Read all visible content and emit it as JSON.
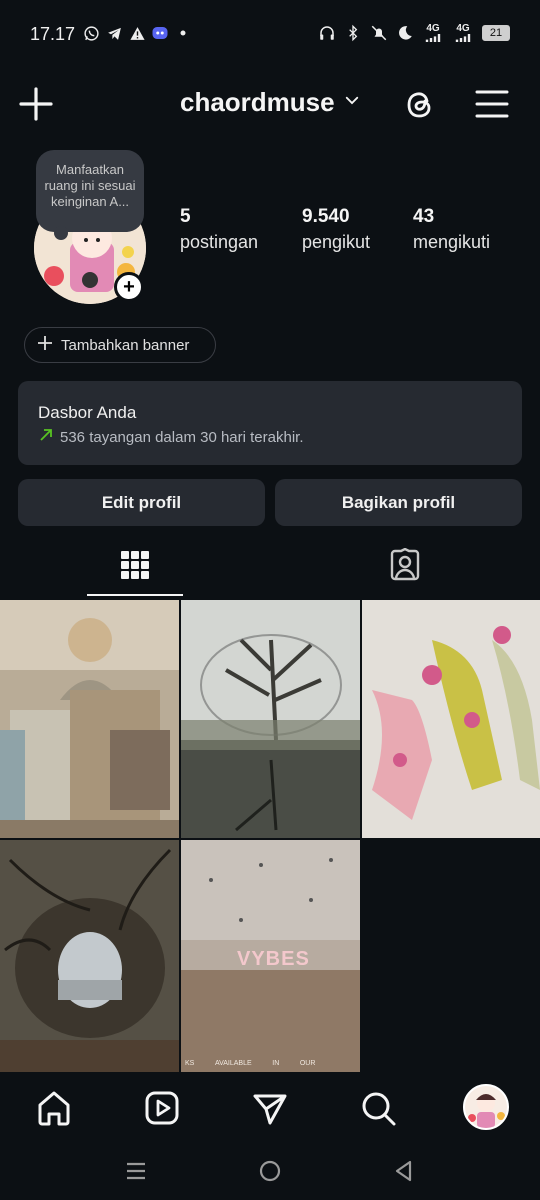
{
  "status_bar": {
    "time": "17.17",
    "network_1": "4G",
    "network_2": "4G",
    "battery": "21"
  },
  "header": {
    "username": "chaordmuse"
  },
  "profile": {
    "note": "Manfaatkan ruang ini sesuai keinginan A...",
    "stats": [
      {
        "value": "5",
        "label": "postingan"
      },
      {
        "value": "9.540",
        "label": "pengikut"
      },
      {
        "value": "43",
        "label": "mengikuti"
      }
    ],
    "add_banner_label": "Tambahkan banner"
  },
  "dashboard": {
    "title": "Dasbor Anda",
    "subtitle": "536 tayangan dalam 30 hari terakhir."
  },
  "buttons": {
    "edit_profile": "Edit profil",
    "share_profile": "Bagikan profil"
  },
  "grid": {
    "post_5_text": "VYBES",
    "post_5_caption": [
      "KS",
      "AVAILABLE",
      "IN",
      "OUR"
    ]
  },
  "colors": {
    "background": "#0c1014",
    "card": "#262a31",
    "accent_green": "#58c322"
  }
}
